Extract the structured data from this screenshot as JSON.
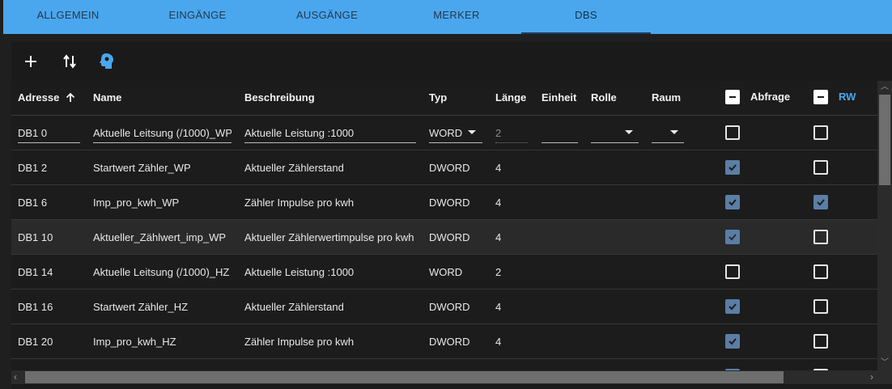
{
  "tabs": [
    {
      "label": "ALLGEMEIN"
    },
    {
      "label": "EINGÄNGE"
    },
    {
      "label": "AUSGÄNGE"
    },
    {
      "label": "MERKER"
    },
    {
      "label": "DBS"
    }
  ],
  "active_tab": "DBS",
  "toolbar": {
    "icons": [
      "add-icon",
      "sort-arrows-icon",
      "head-profile-icon"
    ]
  },
  "columns": {
    "adresse": "Adresse",
    "name": "Name",
    "beschreibung": "Beschreibung",
    "typ": "Typ",
    "laenge": "Länge",
    "einheit": "Einheit",
    "rolle": "Rolle",
    "raum": "Raum",
    "abfrage": "Abfrage",
    "rw": "RW"
  },
  "sort": {
    "column": "Adresse",
    "direction": "ascending"
  },
  "edit_row": {
    "adresse": "DB1 0",
    "name": "Aktuelle Leitsung (/1000)_WP",
    "beschreibung": "Aktuelle Leistung :1000",
    "typ": "WORD",
    "laenge": "2",
    "einheit": "",
    "rolle": "",
    "raum": "",
    "abfrage": false,
    "rw": false
  },
  "rows": [
    {
      "adresse": "DB1 2",
      "name": "Startwert Zähler_WP",
      "beschreibung": "Aktueller Zählerstand",
      "typ": "DWORD",
      "laenge": "4",
      "abfrage": true,
      "rw": false
    },
    {
      "adresse": "DB1 6",
      "name": "Imp_pro_kwh_WP",
      "beschreibung": "Zähler Impulse pro kwh",
      "typ": "DWORD",
      "laenge": "4",
      "abfrage": true,
      "rw": true
    },
    {
      "adresse": "DB1 10",
      "name": "Aktueller_Zählwert_imp_WP",
      "beschreibung": "Aktueller Zählerwertimpulse pro kwh",
      "typ": "DWORD",
      "laenge": "4",
      "abfrage": true,
      "rw": false
    },
    {
      "adresse": "DB1 14",
      "name": "Aktuelle Leitsung (/1000)_HZ",
      "beschreibung": "Aktuelle Leistung :1000",
      "typ": "WORD",
      "laenge": "2",
      "abfrage": false,
      "rw": false
    },
    {
      "adresse": "DB1 16",
      "name": "Startwert Zähler_HZ",
      "beschreibung": "Aktueller Zählerstand",
      "typ": "DWORD",
      "laenge": "4",
      "abfrage": true,
      "rw": false
    },
    {
      "adresse": "DB1 20",
      "name": "Imp_pro_kwh_HZ",
      "beschreibung": "Zähler Impulse pro kwh",
      "typ": "DWORD",
      "laenge": "4",
      "abfrage": true,
      "rw": false
    }
  ],
  "colors": {
    "tabbar": "#4aa7ee",
    "checkbox_checked": "#5a7ea6",
    "rw_header": "#4aa7ee"
  }
}
